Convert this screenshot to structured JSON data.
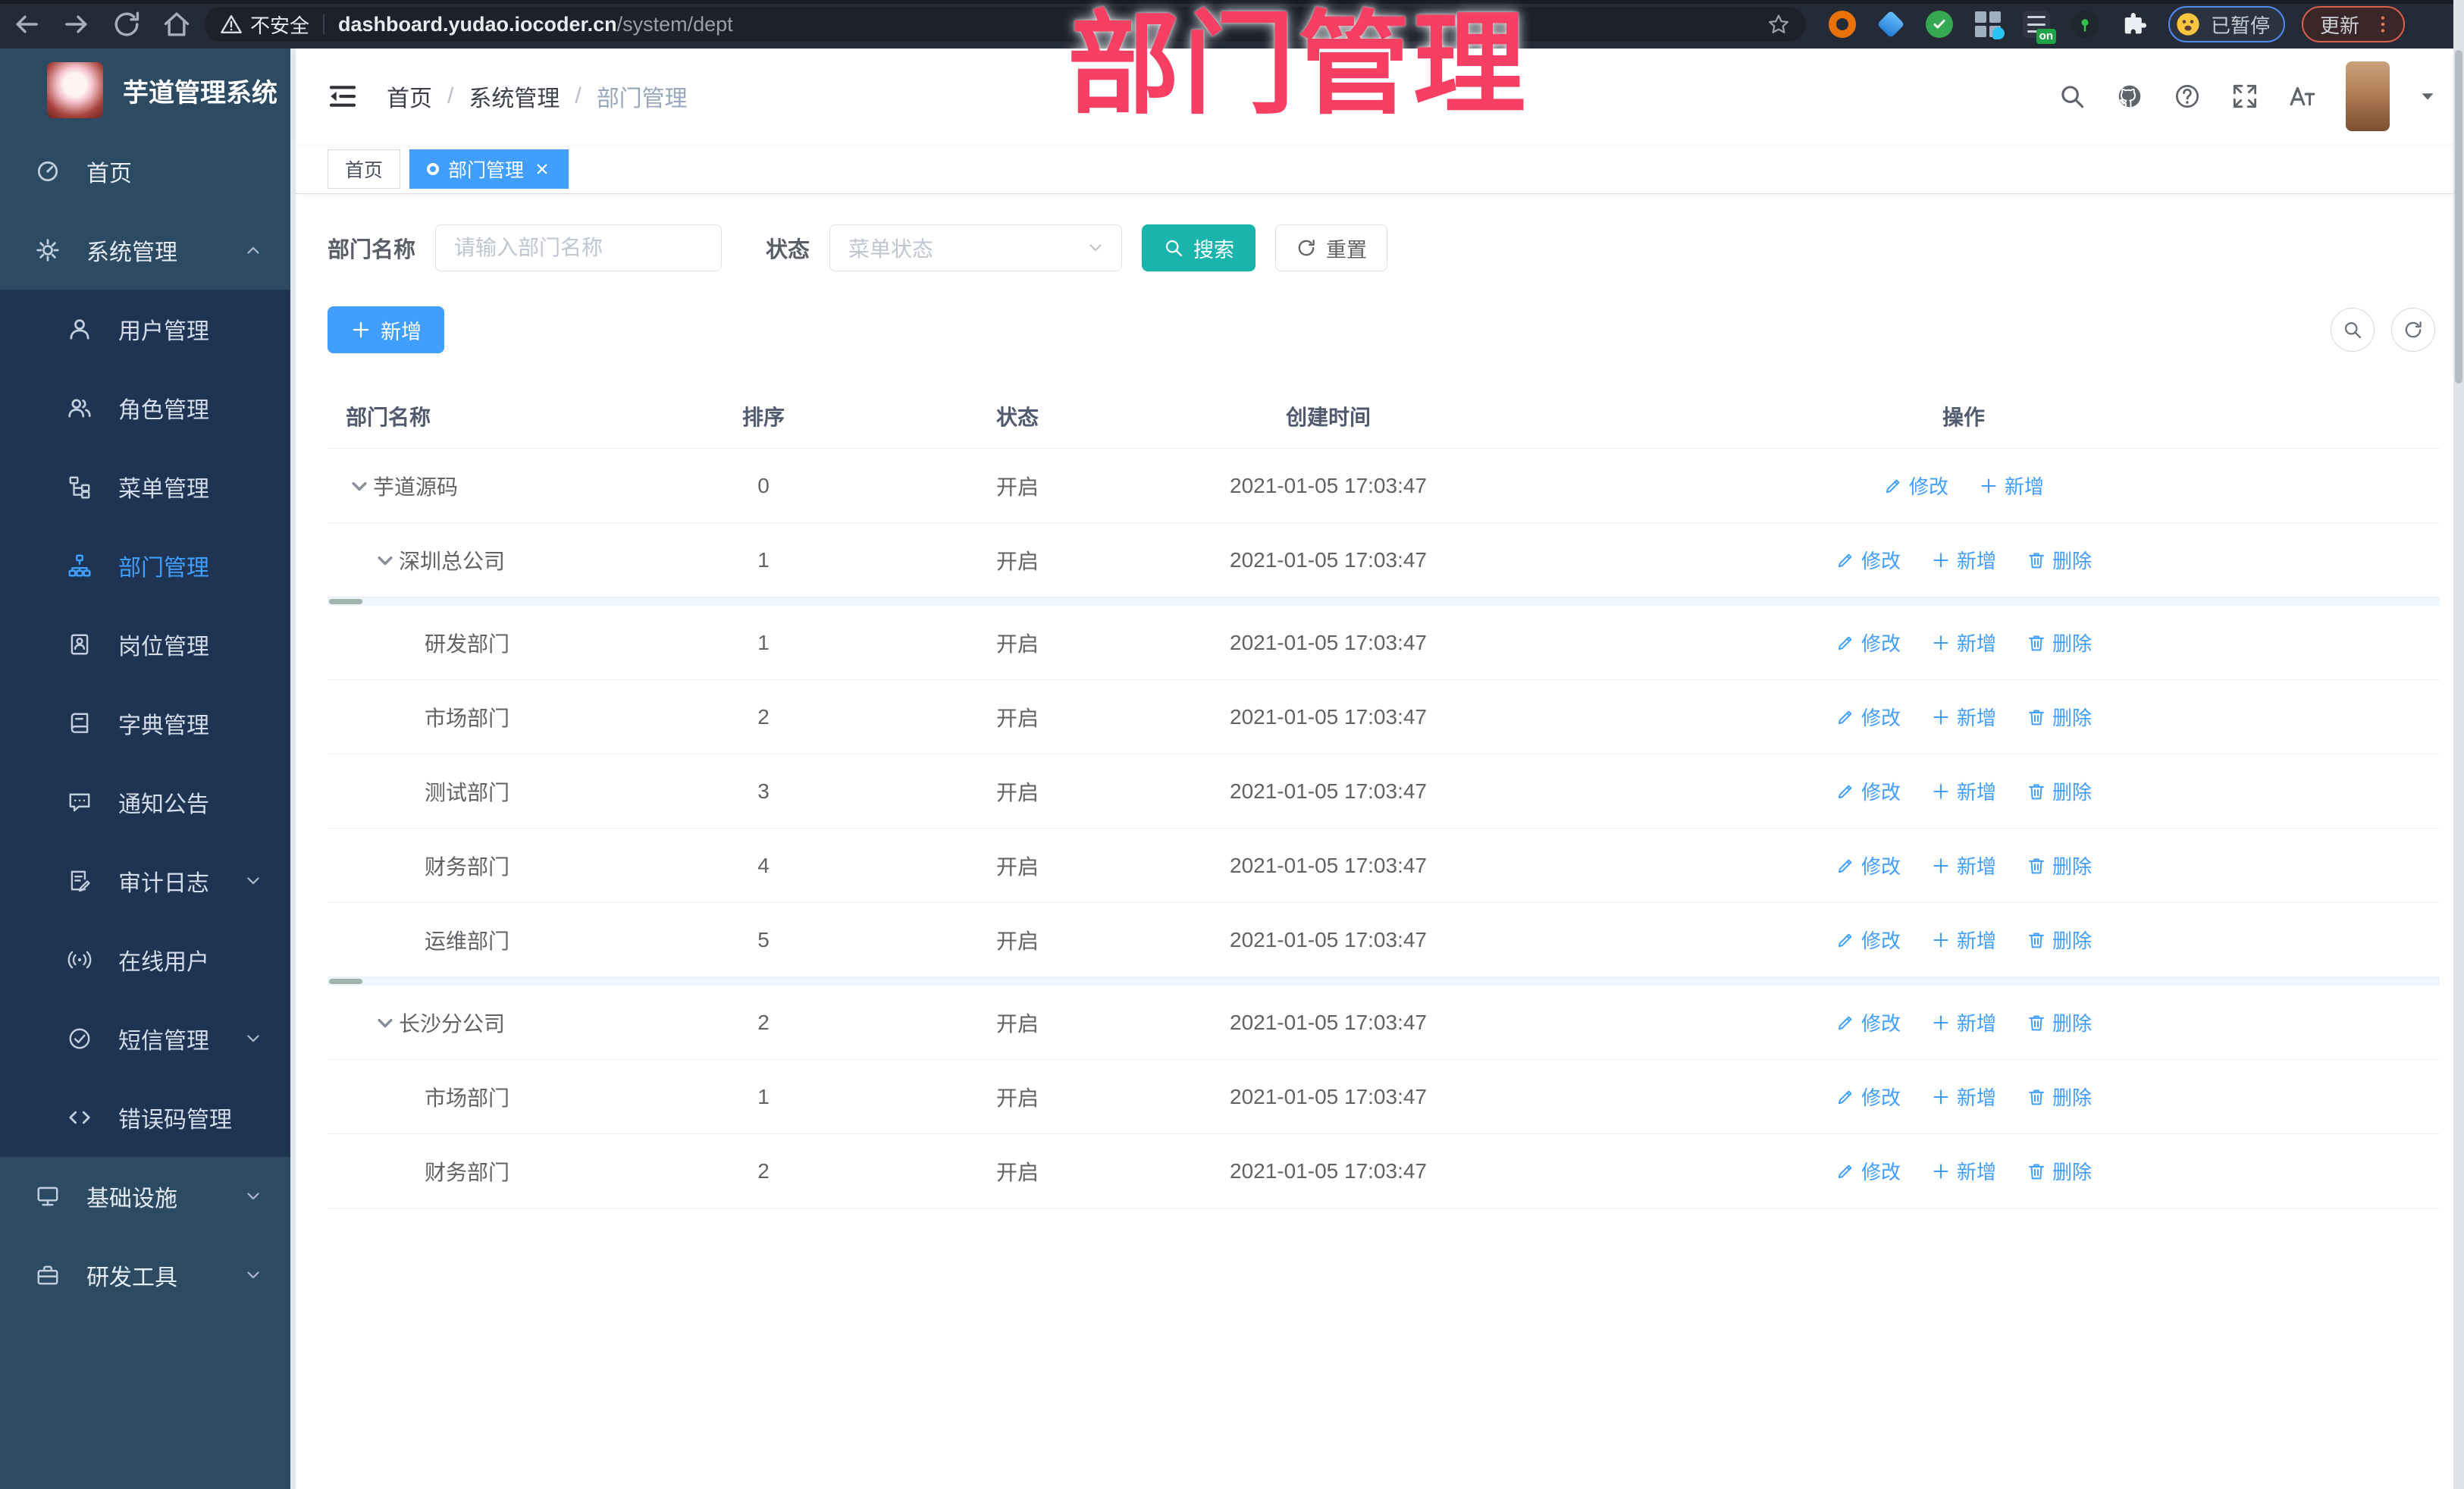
{
  "browser": {
    "security_label": "不安全",
    "url_host": "dashboard.yudao.iocoder.cn",
    "url_path": "/system/dept",
    "extension_badge": "on",
    "profile_status": "已暂停",
    "update_label": "更新"
  },
  "overlay": {
    "title": "部门管理",
    "color": "#f73e63"
  },
  "sidebar": {
    "logo_title": "芋道管理系统",
    "items": [
      {
        "label": "首页",
        "icon": "dashboard-icon",
        "depth": 0
      },
      {
        "label": "系统管理",
        "icon": "gear-icon",
        "depth": 0,
        "chevron": "up"
      },
      {
        "label": "用户管理",
        "icon": "user-icon",
        "depth": 1
      },
      {
        "label": "角色管理",
        "icon": "role-icon",
        "depth": 1
      },
      {
        "label": "菜单管理",
        "icon": "menu-tree-icon",
        "depth": 1
      },
      {
        "label": "部门管理",
        "icon": "dept-icon",
        "depth": 1,
        "active": true
      },
      {
        "label": "岗位管理",
        "icon": "post-icon",
        "depth": 1
      },
      {
        "label": "字典管理",
        "icon": "dict-icon",
        "depth": 1
      },
      {
        "label": "通知公告",
        "icon": "notice-icon",
        "depth": 1
      },
      {
        "label": "审计日志",
        "icon": "audit-icon",
        "depth": 1,
        "chevron": "down"
      },
      {
        "label": "在线用户",
        "icon": "online-icon",
        "depth": 1
      },
      {
        "label": "短信管理",
        "icon": "sms-icon",
        "depth": 1,
        "chevron": "down"
      },
      {
        "label": "错误码管理",
        "icon": "code-icon",
        "depth": 1
      },
      {
        "label": "基础设施",
        "icon": "infra-icon",
        "depth": 0,
        "chevron": "down"
      },
      {
        "label": "研发工具",
        "icon": "tool-icon",
        "depth": 0,
        "chevron": "down"
      }
    ]
  },
  "topbar": {
    "breadcrumb": [
      {
        "label": "首页",
        "current": false
      },
      {
        "label": "系统管理",
        "current": false
      },
      {
        "label": "部门管理",
        "current": true
      }
    ]
  },
  "tabs": [
    {
      "label": "首页",
      "active": false,
      "closable": false
    },
    {
      "label": "部门管理",
      "active": true,
      "closable": true
    }
  ],
  "filters": {
    "dept_name_label": "部门名称",
    "dept_name_placeholder": "请输入部门名称",
    "status_label": "状态",
    "status_placeholder": "菜单状态",
    "search_label": "搜索",
    "reset_label": "重置"
  },
  "toolbar": {
    "add_label": "新增"
  },
  "table": {
    "columns": [
      "部门名称",
      "排序",
      "状态",
      "创建时间",
      "操作"
    ],
    "rows": [
      {
        "name": "芋道源码",
        "level": 0,
        "expanded": true,
        "sort": "0",
        "status": "开启",
        "created": "2021-01-05 17:03:47",
        "actions": [
          {
            "label": "修改",
            "icon": "edit-icon"
          },
          {
            "label": "新增",
            "icon": "plus-icon"
          }
        ]
      },
      {
        "name": "深圳总公司",
        "level": 1,
        "expanded": true,
        "sort": "1",
        "status": "开启",
        "created": "2021-01-05 17:03:47",
        "actions": [
          {
            "label": "修改",
            "icon": "edit-icon"
          },
          {
            "label": "新增",
            "icon": "plus-icon"
          },
          {
            "label": "删除",
            "icon": "delete-icon"
          }
        ]
      },
      {
        "name": "研发部门",
        "level": 2,
        "band_above": true,
        "sort": "1",
        "status": "开启",
        "created": "2021-01-05 17:03:47",
        "actions": [
          {
            "label": "修改",
            "icon": "edit-icon"
          },
          {
            "label": "新增",
            "icon": "plus-icon"
          },
          {
            "label": "删除",
            "icon": "delete-icon"
          }
        ]
      },
      {
        "name": "市场部门",
        "level": 2,
        "sort": "2",
        "status": "开启",
        "created": "2021-01-05 17:03:47",
        "actions": [
          {
            "label": "修改",
            "icon": "edit-icon"
          },
          {
            "label": "新增",
            "icon": "plus-icon"
          },
          {
            "label": "删除",
            "icon": "delete-icon"
          }
        ]
      },
      {
        "name": "测试部门",
        "level": 2,
        "sort": "3",
        "status": "开启",
        "created": "2021-01-05 17:03:47",
        "actions": [
          {
            "label": "修改",
            "icon": "edit-icon"
          },
          {
            "label": "新增",
            "icon": "plus-icon"
          },
          {
            "label": "删除",
            "icon": "delete-icon"
          }
        ]
      },
      {
        "name": "财务部门",
        "level": 2,
        "sort": "4",
        "status": "开启",
        "created": "2021-01-05 17:03:47",
        "actions": [
          {
            "label": "修改",
            "icon": "edit-icon"
          },
          {
            "label": "新增",
            "icon": "plus-icon"
          },
          {
            "label": "删除",
            "icon": "delete-icon"
          }
        ]
      },
      {
        "name": "运维部门",
        "level": 2,
        "sort": "5",
        "status": "开启",
        "created": "2021-01-05 17:03:47",
        "actions": [
          {
            "label": "修改",
            "icon": "edit-icon"
          },
          {
            "label": "新增",
            "icon": "plus-icon"
          },
          {
            "label": "删除",
            "icon": "delete-icon"
          }
        ]
      },
      {
        "name": "长沙分公司",
        "level": 1,
        "expanded": true,
        "band_above": true,
        "sort": "2",
        "status": "开启",
        "created": "2021-01-05 17:03:47",
        "actions": [
          {
            "label": "修改",
            "icon": "edit-icon"
          },
          {
            "label": "新增",
            "icon": "plus-icon"
          },
          {
            "label": "删除",
            "icon": "delete-icon"
          }
        ]
      },
      {
        "name": "市场部门",
        "level": 2,
        "sort": "1",
        "status": "开启",
        "created": "2021-01-05 17:03:47",
        "actions": [
          {
            "label": "修改",
            "icon": "edit-icon"
          },
          {
            "label": "新增",
            "icon": "plus-icon"
          },
          {
            "label": "删除",
            "icon": "delete-icon"
          }
        ]
      },
      {
        "name": "财务部门",
        "level": 2,
        "sort": "2",
        "status": "开启",
        "created": "2021-01-05 17:03:47",
        "actions": [
          {
            "label": "修改",
            "icon": "edit-icon"
          },
          {
            "label": "新增",
            "icon": "plus-icon"
          },
          {
            "label": "删除",
            "icon": "delete-icon"
          }
        ]
      }
    ]
  },
  "colors": {
    "primary": "#409eff",
    "search_teal": "#19b5ad",
    "overlay_pink": "#f73e63",
    "sidebar_bg": "#2d4a63",
    "submenu_bg": "#1e3452"
  }
}
